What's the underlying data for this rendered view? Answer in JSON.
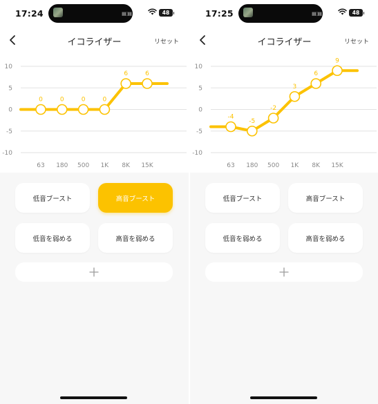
{
  "colors": {
    "accent": "#fcc200",
    "grid": "#e2e2e2",
    "axis_text": "#888888"
  },
  "screens": [
    {
      "status": {
        "time": "17:24",
        "battery": "48"
      },
      "nav": {
        "title": "イコライザー",
        "reset": "リセット"
      },
      "chart_data": {
        "type": "line",
        "categories": [
          "63",
          "180",
          "500",
          "1K",
          "8K",
          "15K"
        ],
        "values": [
          0,
          0,
          0,
          0,
          6,
          6
        ],
        "ylim": [
          -10,
          10
        ],
        "yticks": [
          "10",
          "5",
          "0",
          "-5",
          "-10"
        ],
        "grid": true
      },
      "presets": [
        {
          "label": "低音ブースト",
          "active": false
        },
        {
          "label": "高音ブースト",
          "active": true
        },
        {
          "label": "低音を弱める",
          "active": false
        },
        {
          "label": "高音を弱める",
          "active": false
        }
      ]
    },
    {
      "status": {
        "time": "17:25",
        "battery": "48"
      },
      "nav": {
        "title": "イコライザー",
        "reset": "リセット"
      },
      "chart_data": {
        "type": "line",
        "categories": [
          "63",
          "180",
          "500",
          "1K",
          "8K",
          "15K"
        ],
        "values": [
          -4,
          -5,
          -2,
          3,
          6,
          9
        ],
        "ylim": [
          -10,
          10
        ],
        "yticks": [
          "10",
          "5",
          "0",
          "-5",
          "-10"
        ],
        "grid": true
      },
      "presets": [
        {
          "label": "低音ブースト",
          "active": false
        },
        {
          "label": "高音ブースト",
          "active": false
        },
        {
          "label": "低音を弱める",
          "active": false
        },
        {
          "label": "高音を弱める",
          "active": false
        }
      ]
    }
  ]
}
